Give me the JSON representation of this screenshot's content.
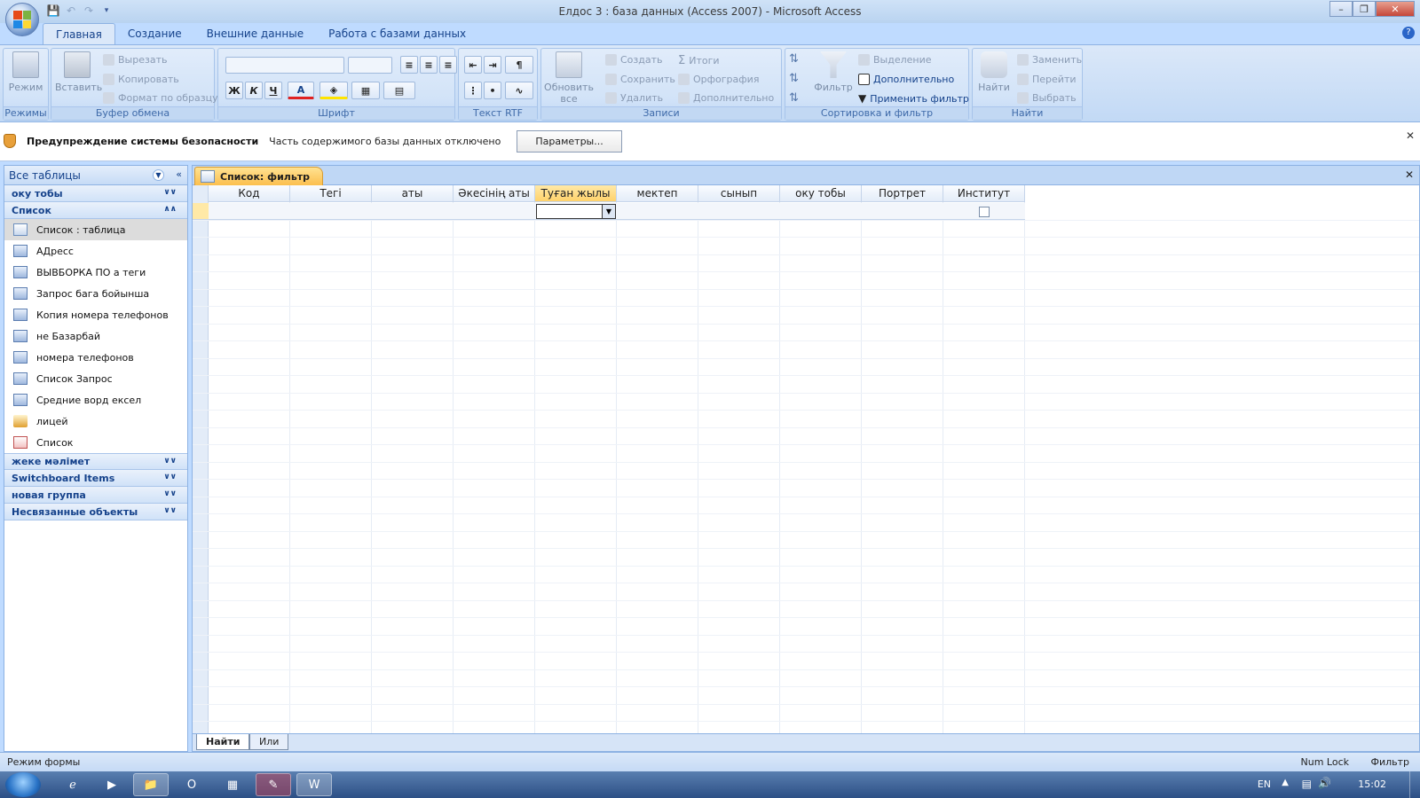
{
  "window": {
    "title": "Елдос 3 : база данных (Access 2007)  -  Microsoft Access"
  },
  "ribbon_tabs": [
    "Главная",
    "Создание",
    "Внешние данные",
    "Работа с базами данных"
  ],
  "ribbon": {
    "groups": {
      "modes": "Режимы",
      "clipboard": "Буфер обмена",
      "font": "Шрифт",
      "rtf": "Текст RTF",
      "records": "Записи",
      "sortfilter": "Сортировка и фильтр",
      "find": "Найти"
    },
    "mode_button": "Режим",
    "paste_button": "Вставить",
    "cut": "Вырезать",
    "copy": "Копировать",
    "format_painter": "Формат по образцу",
    "refresh_line1": "Обновить",
    "refresh_line2": "все",
    "create": "Создать",
    "save": "Сохранить",
    "delete": "Удалить",
    "totals": "Итоги",
    "spelling": "Орфография",
    "more": "Дополнительно",
    "filter": "Фильтр",
    "selection": "Выделение",
    "advanced": "Дополнительно",
    "apply_filter": "Применить фильтр",
    "find": "Найти",
    "replace": "Заменить",
    "goto": "Перейти",
    "select": "Выбрать",
    "bold": "Ж",
    "italic": "К",
    "underline": "Ч",
    "font_color_letter": "A"
  },
  "security": {
    "title": "Предупреждение системы безопасности",
    "message": "Часть содержимого базы данных отключено",
    "button": "Параметры..."
  },
  "nav": {
    "header": "Все таблицы",
    "groups_top": [
      "оку тобы"
    ],
    "open_group": "Список",
    "items": [
      {
        "label": "Список : таблица",
        "icon": "table-icon",
        "selected": true
      },
      {
        "label": "АДресс",
        "icon": "query-icon"
      },
      {
        "label": "ВЫВБОРКА  ПО а теги",
        "icon": "query-icon"
      },
      {
        "label": "Запрос бага бойынша",
        "icon": "query-icon"
      },
      {
        "label": "Копия номера телефонов",
        "icon": "query-icon"
      },
      {
        "label": "не Базарбай",
        "icon": "query-icon"
      },
      {
        "label": "номера телефонов",
        "icon": "query-icon"
      },
      {
        "label": "Список Запрос",
        "icon": "query-icon"
      },
      {
        "label": "Средние ворд ексел",
        "icon": "query-icon"
      },
      {
        "label": "лицей",
        "icon": "macro-icon"
      },
      {
        "label": "Список",
        "icon": "form-icon"
      }
    ],
    "groups_bottom": [
      "жеке мәлімет",
      "Switchboard Items",
      "новая группа",
      "Несвязанные объекты"
    ]
  },
  "document": {
    "tab_label": "Список: фильтр",
    "columns": [
      "Код",
      "Тегі",
      "аты",
      "Әкесінің аты",
      "Туған жылы",
      "мектеп",
      "сынып",
      "оку тобы",
      "Портрет",
      "Институт"
    ],
    "active_column": "Туған жылы",
    "sheet_tabs": [
      "Найти",
      "Или"
    ]
  },
  "status": {
    "left": "Режим формы",
    "numlock": "Num Lock",
    "filter": "Фильтр"
  },
  "taskbar": {
    "lang": "EN",
    "time": "15:02"
  },
  "colors": {
    "accent": "#15428b",
    "doctab": "#fbbf4e",
    "ribbon_bg": "#dbe8f9"
  }
}
